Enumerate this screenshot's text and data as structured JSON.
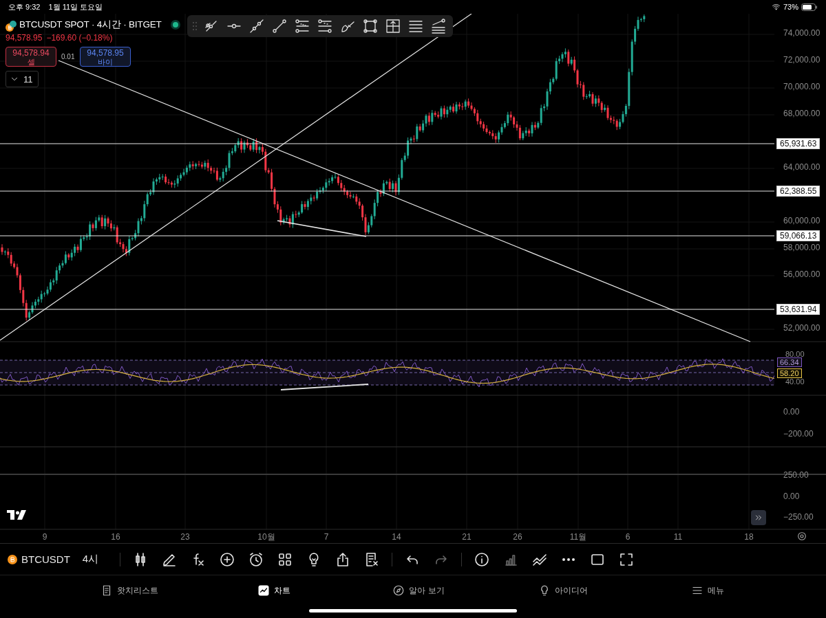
{
  "status_bar": {
    "time": "오후 9:32",
    "date": "1월 11일 토요일",
    "battery": "73%"
  },
  "symbol": {
    "title": "BTCUSDT SPOT · 4시간 · BITGET"
  },
  "quote": {
    "price": "94,578.95",
    "change": "−169.60 (−0.18%)"
  },
  "trade": {
    "sell": {
      "price": "94,578.94",
      "label": "셀"
    },
    "spread": "0.01",
    "buy": {
      "price": "94,578.95",
      "label": "바이"
    }
  },
  "indicators": {
    "count": "11",
    "expanded": false
  },
  "price_axis": {
    "ticks": [
      "74,000.00",
      "72,000.00",
      "70,000.00",
      "68,000.00",
      "64,000.00",
      "60,000.00",
      "58,000.00",
      "56,000.00",
      "52,000.00"
    ],
    "price_lines": [
      "65,931.63",
      "62,388.55",
      "59,066.13",
      "53,631.94"
    ]
  },
  "rsi": {
    "upper": "80.00",
    "value": "66.34",
    "ma": "58.20",
    "lower": "40.00"
  },
  "pane_2": {
    "ticks": [
      "0.00",
      "−200.00"
    ]
  },
  "pane_3": {
    "ticks": [
      "250.00",
      "0.00",
      "−250.00"
    ]
  },
  "time_axis": [
    "9",
    "16",
    "23",
    "10월",
    "7",
    "14",
    "21",
    "26",
    "11월",
    "6",
    "11",
    "18"
  ],
  "bottom_toolbar": {
    "symbol": "BTCUSDT",
    "interval": "4시",
    "tools": [
      {
        "kind": "chart-type",
        "disabled": false
      },
      {
        "kind": "draw",
        "disabled": false
      },
      {
        "kind": "fx",
        "disabled": false
      },
      {
        "kind": "add",
        "disabled": false
      },
      {
        "kind": "alarm",
        "disabled": false
      },
      {
        "kind": "layout",
        "disabled": false
      },
      {
        "kind": "bulb",
        "disabled": false
      },
      {
        "kind": "share",
        "disabled": false
      },
      {
        "kind": "list-x",
        "disabled": false
      },
      {
        "kind": "undo",
        "disabled": false
      },
      {
        "kind": "redo",
        "disabled": true
      },
      {
        "kind": "info",
        "disabled": false
      },
      {
        "kind": "bars",
        "disabled": true
      },
      {
        "kind": "compare",
        "disabled": false
      },
      {
        "kind": "more",
        "disabled": false
      },
      {
        "kind": "square",
        "disabled": false
      },
      {
        "kind": "fullscreen",
        "disabled": false
      }
    ]
  },
  "tab_bar": [
    {
      "kind": "watchlist",
      "label": "왓치리스트",
      "selected": false
    },
    {
      "kind": "chart",
      "label": "차트",
      "selected": true
    },
    {
      "kind": "explore",
      "label": "알아 보기",
      "selected": false
    },
    {
      "kind": "ideas",
      "label": "아이디어",
      "selected": false
    },
    {
      "kind": "menu",
      "label": "메뉴",
      "selected": false
    }
  ]
}
